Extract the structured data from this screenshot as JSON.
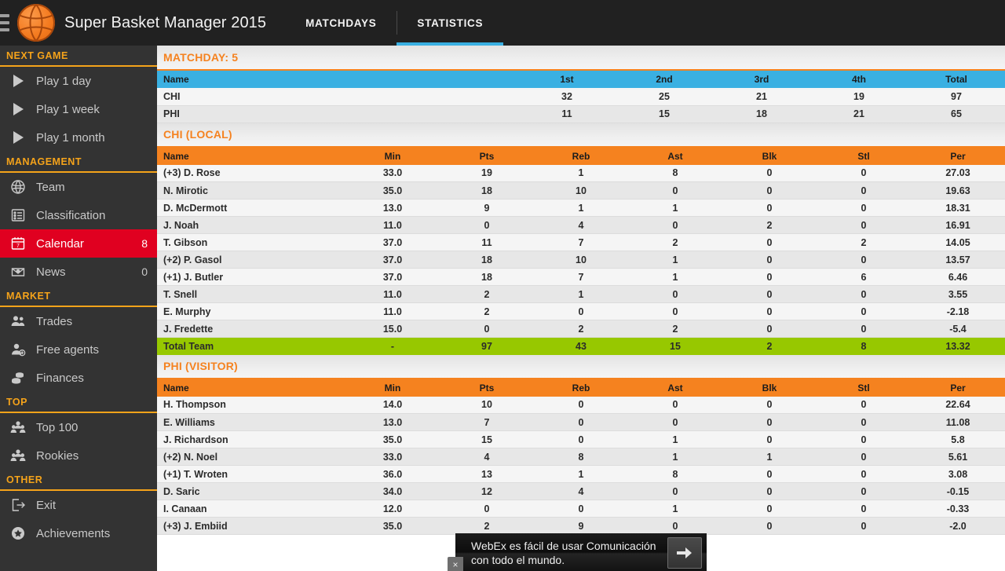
{
  "topbar": {
    "menu_icon": "hamburger-icon",
    "logo_icon": "basketball-icon",
    "title": "Super Basket Manager 2015",
    "tabs": [
      {
        "label": "MATCHDAYS",
        "active": false
      },
      {
        "label": "STATISTICS",
        "active": true
      }
    ],
    "bg": "#212121",
    "accent": "#3ab0e2"
  },
  "sidebar": {
    "bg": "#333333",
    "header_color": "#f5a31a",
    "active_color": "#e00020",
    "groups": [
      {
        "title": "NEXT GAME",
        "items": [
          {
            "label": "Play 1 day",
            "icon": "play-icon",
            "badge": "",
            "active": false
          },
          {
            "label": "Play 1 week",
            "icon": "play-icon",
            "badge": "",
            "active": false
          },
          {
            "label": "Play 1 month",
            "icon": "play-icon",
            "badge": "",
            "active": false
          }
        ]
      },
      {
        "title": "MANAGEMENT",
        "items": [
          {
            "label": "Team",
            "icon": "basketball-icon",
            "badge": "",
            "active": false
          },
          {
            "label": "Classification",
            "icon": "list-icon",
            "badge": "",
            "active": false
          },
          {
            "label": "Calendar",
            "icon": "calendar-icon",
            "badge": "8",
            "active": true
          },
          {
            "label": "News",
            "icon": "mail-icon",
            "badge": "0",
            "active": false
          }
        ]
      },
      {
        "title": "MARKET",
        "items": [
          {
            "label": "Trades",
            "icon": "users-icon",
            "badge": "",
            "active": false
          },
          {
            "label": "Free agents",
            "icon": "user-add-icon",
            "badge": "",
            "active": false
          },
          {
            "label": "Finances",
            "icon": "coins-icon",
            "badge": "",
            "active": false
          }
        ]
      },
      {
        "title": "TOP",
        "items": [
          {
            "label": "Top 100",
            "icon": "group-icon",
            "badge": "",
            "active": false
          },
          {
            "label": "Rookies",
            "icon": "group-icon",
            "badge": "",
            "active": false
          }
        ]
      },
      {
        "title": "OTHER",
        "items": [
          {
            "label": "Exit",
            "icon": "exit-icon",
            "badge": "",
            "active": false
          },
          {
            "label": "Achievements",
            "icon": "medal-icon",
            "badge": "",
            "active": false
          }
        ]
      }
    ]
  },
  "main": {
    "matchday_heading": "MATCHDAY: 5",
    "scoreboard": {
      "headers": [
        "Name",
        "1st",
        "2nd",
        "3rd",
        "4th",
        "Total"
      ],
      "rows": [
        {
          "cells": [
            "CHI",
            "32",
            "25",
            "21",
            "19",
            "97"
          ]
        },
        {
          "cells": [
            "PHI",
            "11",
            "15",
            "18",
            "21",
            "65"
          ]
        }
      ]
    },
    "local_heading": "CHI (LOCAL)",
    "visitor_heading": "PHI (VISITOR)",
    "player_headers": [
      "Name",
      "Min",
      "Pts",
      "Reb",
      "Ast",
      "Blk",
      "Stl",
      "Per"
    ],
    "local_rows": [
      {
        "cells": [
          "(+3) D. Rose",
          "33.0",
          "19",
          "1",
          "8",
          "0",
          "0",
          "27.03"
        ],
        "total": false
      },
      {
        "cells": [
          "N. Mirotic",
          "35.0",
          "18",
          "10",
          "0",
          "0",
          "0",
          "19.63"
        ],
        "total": false
      },
      {
        "cells": [
          "D. McDermott",
          "13.0",
          "9",
          "1",
          "1",
          "0",
          "0",
          "18.31"
        ],
        "total": false
      },
      {
        "cells": [
          "J. Noah",
          "11.0",
          "0",
          "4",
          "0",
          "2",
          "0",
          "16.91"
        ],
        "total": false
      },
      {
        "cells": [
          "T. Gibson",
          "37.0",
          "11",
          "7",
          "2",
          "0",
          "2",
          "14.05"
        ],
        "total": false
      },
      {
        "cells": [
          "(+2) P. Gasol",
          "37.0",
          "18",
          "10",
          "1",
          "0",
          "0",
          "13.57"
        ],
        "total": false
      },
      {
        "cells": [
          "(+1) J. Butler",
          "37.0",
          "18",
          "7",
          "1",
          "0",
          "6",
          "6.46"
        ],
        "total": false
      },
      {
        "cells": [
          "T. Snell",
          "11.0",
          "2",
          "1",
          "0",
          "0",
          "0",
          "3.55"
        ],
        "total": false
      },
      {
        "cells": [
          "E. Murphy",
          "11.0",
          "2",
          "0",
          "0",
          "0",
          "0",
          "-2.18"
        ],
        "total": false
      },
      {
        "cells": [
          "J. Fredette",
          "15.0",
          "0",
          "2",
          "2",
          "0",
          "0",
          "-5.4"
        ],
        "total": false
      },
      {
        "cells": [
          "Total Team",
          "-",
          "97",
          "43",
          "15",
          "2",
          "8",
          "13.32"
        ],
        "total": true
      }
    ],
    "visitor_rows": [
      {
        "cells": [
          "H. Thompson",
          "14.0",
          "10",
          "0",
          "0",
          "0",
          "0",
          "22.64"
        ],
        "total": false
      },
      {
        "cells": [
          "E. Williams",
          "13.0",
          "7",
          "0",
          "0",
          "0",
          "0",
          "11.08"
        ],
        "total": false
      },
      {
        "cells": [
          "J. Richardson",
          "35.0",
          "15",
          "0",
          "1",
          "0",
          "0",
          "5.8"
        ],
        "total": false
      },
      {
        "cells": [
          "(+2) N. Noel",
          "33.0",
          "4",
          "8",
          "1",
          "1",
          "0",
          "5.61"
        ],
        "total": false
      },
      {
        "cells": [
          "(+1) T. Wroten",
          "36.0",
          "13",
          "1",
          "8",
          "0",
          "0",
          "3.08"
        ],
        "total": false
      },
      {
        "cells": [
          "D. Saric",
          "34.0",
          "12",
          "4",
          "0",
          "0",
          "0",
          "-0.15"
        ],
        "total": false
      },
      {
        "cells": [
          "I. Canaan",
          "12.0",
          "0",
          "0",
          "1",
          "0",
          "0",
          "-0.33"
        ],
        "total": false
      },
      {
        "cells": [
          "(+3) J. Embiid",
          "35.0",
          "2",
          "9",
          "0",
          "0",
          "0",
          "-2.0"
        ],
        "total": false
      }
    ],
    "colors": {
      "scoreboard_header": "#3ab0e2",
      "player_header": "#f5821f",
      "total_row": "#97c800",
      "section_heading": "#f5821f"
    }
  },
  "ad": {
    "text": "WebEx es fácil de usar Comunicación con todo el mundo.",
    "cta_icon": "arrow-right-icon",
    "close_icon": "close-icon",
    "close_label": "×"
  }
}
